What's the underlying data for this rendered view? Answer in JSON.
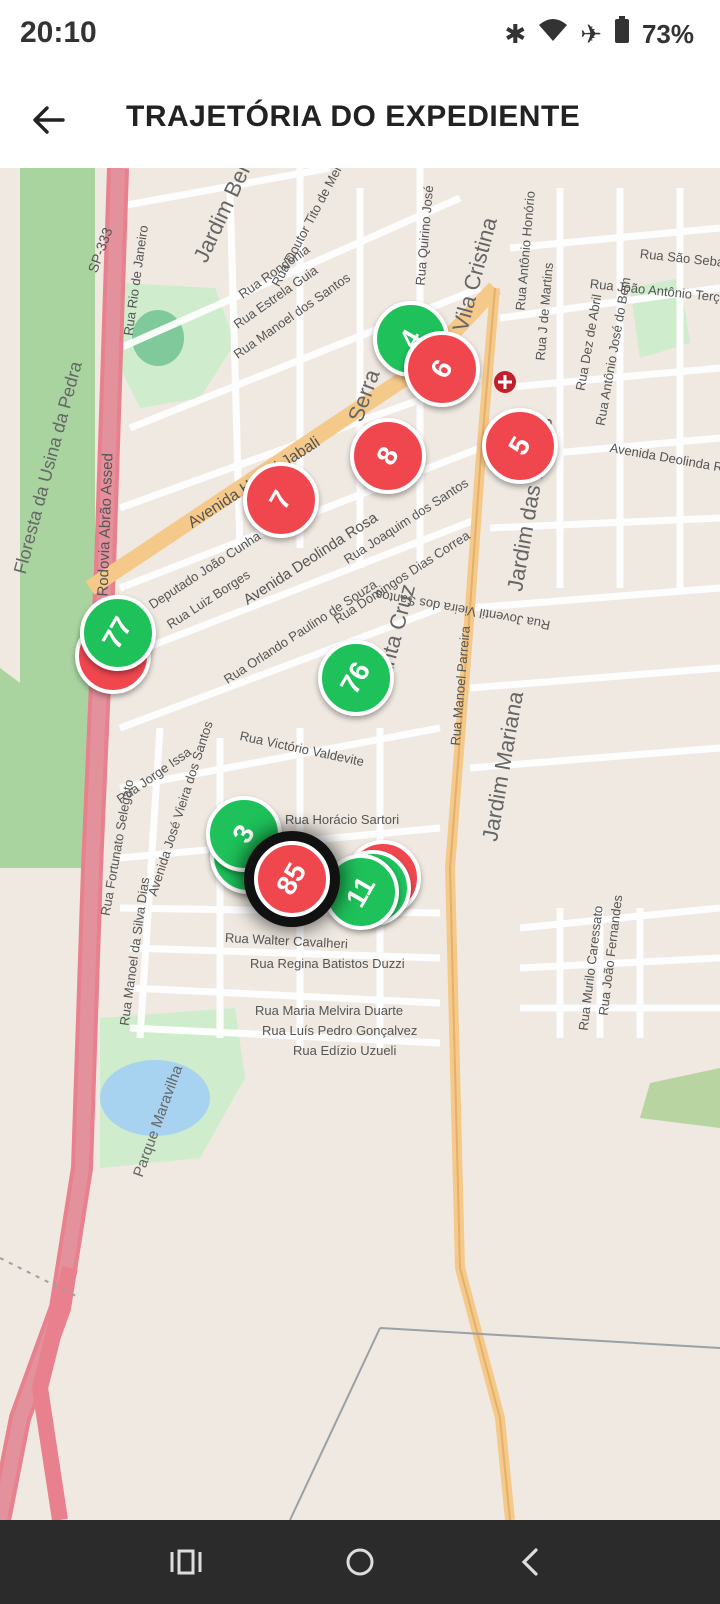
{
  "status_bar": {
    "time": "20:10",
    "icons": [
      "bluetooth-icon",
      "wifi-icon",
      "airplane-icon",
      "battery-icon"
    ],
    "battery": "73%"
  },
  "app_bar": {
    "title": "TRAJETÓRIA DO EXPEDIENTE",
    "back_icon": "arrow-left-icon"
  },
  "map": {
    "streets": [
      "Rodovia Abrão Assed",
      "SP-333",
      "Avenida Habibi Jabali",
      "Avenida Deolinda Rosa",
      "Rua Joaquim dos Santos",
      "Rua Domingos Dias Correa",
      "Rua Orlando Paulino de Souza",
      "Rua Manoel Parreira",
      "Rua Victório Valdevite",
      "Rua Jorge Issa",
      "Rua Fortunato Selegato",
      "Rua Manoel da Silva Dias",
      "Avenida José Vieira dos Santos",
      "Rua Horácio Sartori",
      "Rua Walter Cavalheri",
      "Rua Regina Batistos Duzzi",
      "Rua Maria Melvira Duarte",
      "Rua Luís Pedro Gonçalvez",
      "Rua Edízio Uzueli",
      "Rua Murilo Caressato",
      "Rua João Fernandes",
      "Rua Rio de Janeiro",
      "Rua Rondônia",
      "Rua Estrela Guia",
      "Rua Manoel dos Santos",
      "Rua Doutor Tito de Melo",
      "Rua Quirino José",
      "Rua Antônio Honório",
      "Rua J de Martins",
      "Rua Dez de Abril",
      "Rua Antônio José do Bem",
      "Rua João Antônio Terç",
      "Rua São Seba",
      "Avenida Deolinda R",
      "Rua Joventil Vieira dos Santos",
      "Rua Luiz Borges",
      "Deputado João Cunha"
    ],
    "areas": [
      "Jardim Bela Vista",
      "Vila Cristina",
      "Jardim das Rosas",
      "Jardim Mariana",
      "Floresta da Usina da Pedra",
      "Parque Maravilha",
      "Santa Cruz",
      "Serra"
    ],
    "markers": [
      {
        "label": "4",
        "color": "green"
      },
      {
        "label": "6",
        "color": "red"
      },
      {
        "label": "5",
        "color": "red"
      },
      {
        "label": "8",
        "color": "red"
      },
      {
        "label": "7",
        "color": "red"
      },
      {
        "label": "77",
        "color": "green"
      },
      {
        "label": "76",
        "color": "green"
      },
      {
        "label": "3",
        "color": "green"
      },
      {
        "label": "11",
        "color": "green"
      },
      {
        "label": "85",
        "color": "red",
        "selected": true
      }
    ]
  },
  "nav_bar": {
    "items": [
      "recents-icon",
      "home-icon",
      "back-icon"
    ]
  }
}
